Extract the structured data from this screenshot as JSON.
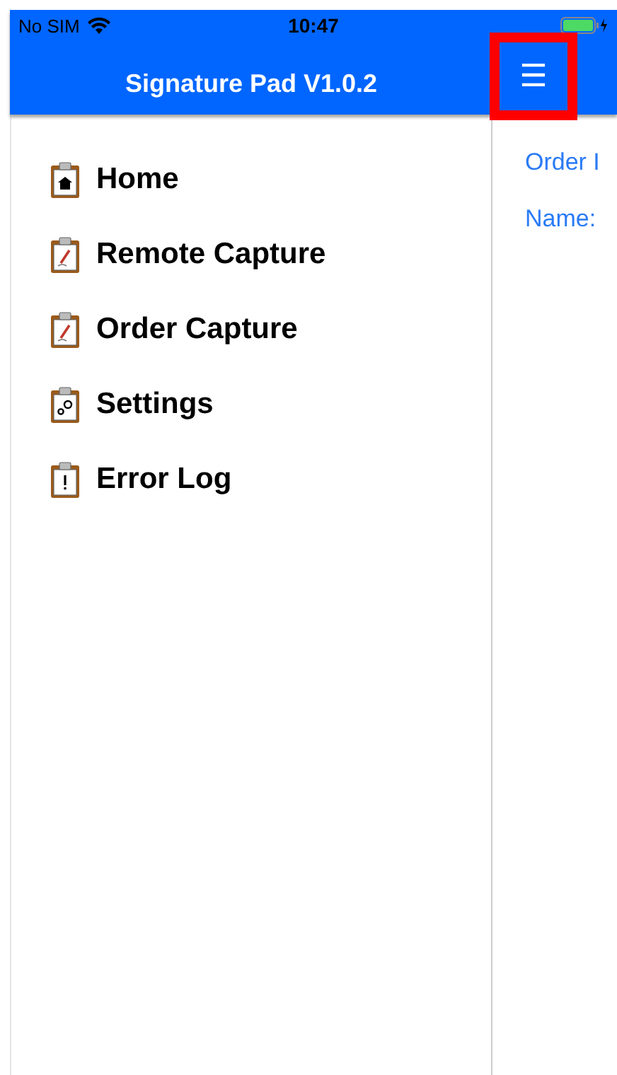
{
  "status_bar": {
    "carrier": "No SIM",
    "time": "10:47"
  },
  "header": {
    "title": "Signature Pad V1.0.2",
    "menu_button": {
      "label": "☰",
      "highlighted": true
    }
  },
  "menu": [
    {
      "label": "Home",
      "kind": "home"
    },
    {
      "label": "Remote Capture",
      "kind": "pen"
    },
    {
      "label": "Order Capture",
      "kind": "pen"
    },
    {
      "label": "Settings",
      "kind": "gear"
    },
    {
      "label": "Error Log",
      "kind": "alert"
    }
  ],
  "content": {
    "fields": [
      "Order I",
      "Name:"
    ]
  }
}
